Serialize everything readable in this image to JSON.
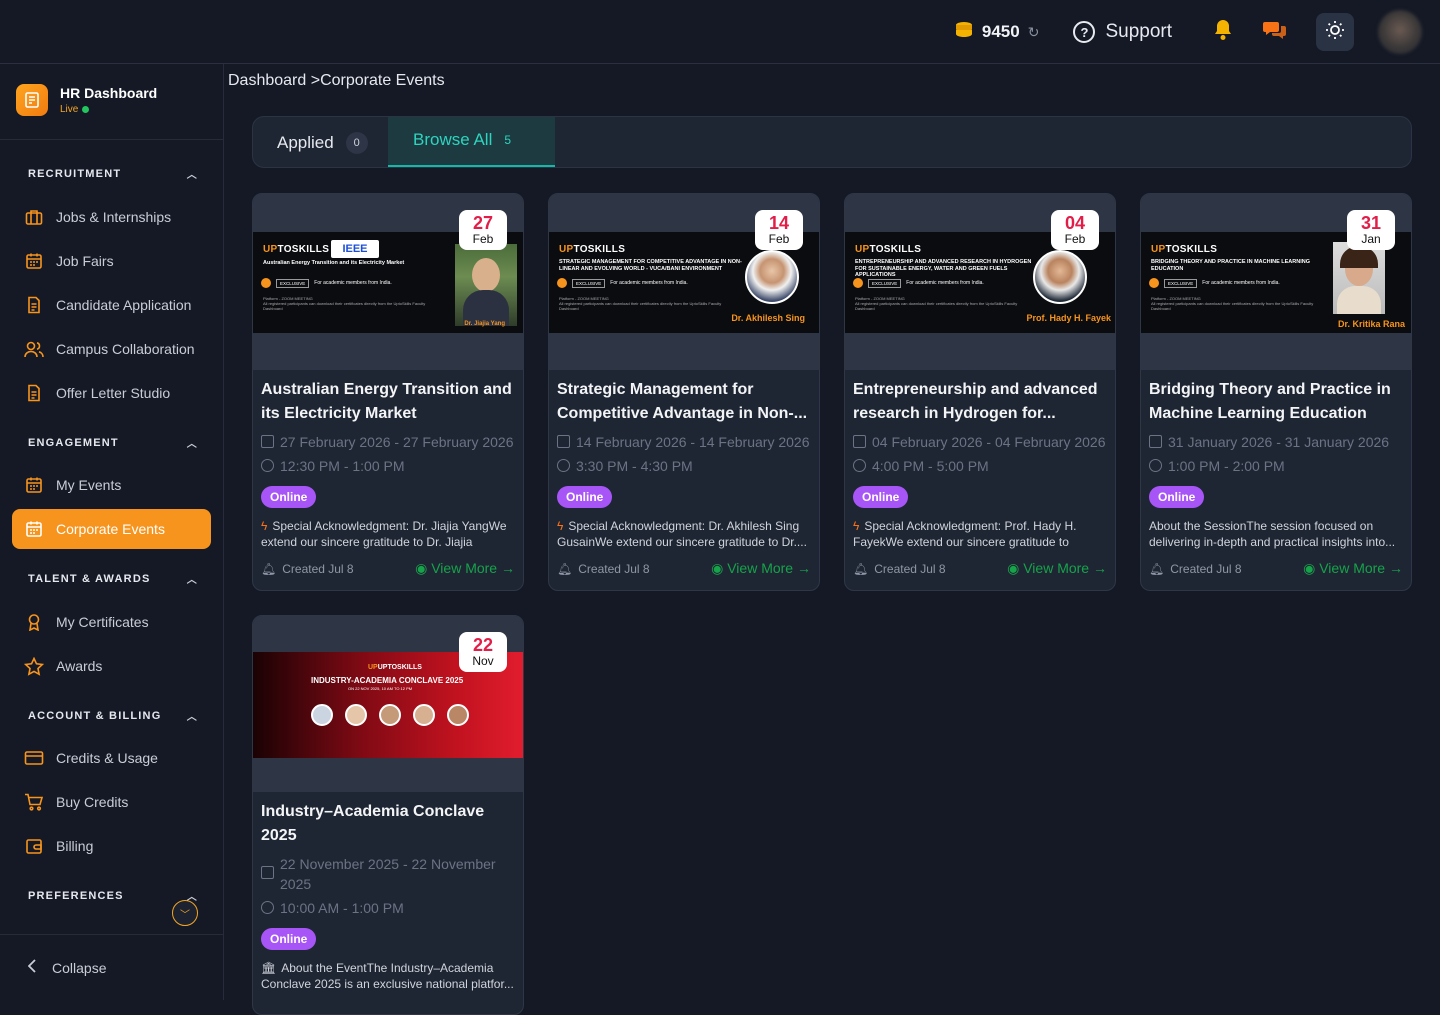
{
  "topbar": {
    "credits": "9450",
    "support_label": "Support"
  },
  "brand": {
    "title": "HR Dashboard",
    "status": "Live"
  },
  "sidebar": {
    "sections": [
      {
        "label": "RECRUITMENT",
        "items": [
          "Jobs & Internships",
          "Job Fairs",
          "Candidate Application",
          "Campus Collaboration",
          "Offer Letter Studio"
        ]
      },
      {
        "label": "ENGAGEMENT",
        "items": [
          "My Events",
          "Corporate Events"
        ]
      },
      {
        "label": "TALENT & AWARDS",
        "items": [
          "My Certificates",
          "Awards"
        ]
      },
      {
        "label": "ACCOUNT & BILLING",
        "items": [
          "Credits & Usage",
          "Buy Credits",
          "Billing"
        ]
      },
      {
        "label": "PREFERENCES",
        "items": []
      }
    ],
    "active_item": "Corporate Events",
    "collapse_label": "Collapse"
  },
  "breadcrumb": "Dashboard >Corporate Events",
  "tabs": [
    {
      "label": "Applied",
      "count": "0"
    },
    {
      "label": "Browse All",
      "count": "5"
    }
  ],
  "colors": {
    "accent": "#f7941d",
    "teal": "#14b8a6",
    "online": "#a855f7",
    "view_more": "#16a34a",
    "date": "#e11d48"
  },
  "events": [
    {
      "day": "27",
      "month": "Feb",
      "title": "Australian Energy Transition and its Electricity Market",
      "dates": "27 February 2026 - 27 February 2026",
      "time": "12:30 PM - 1:00 PM",
      "mode": "Online",
      "desc": "Special Acknowledgment: Dr. Jiajia YangWe extend our sincere gratitude to Dr. Jiajia Yang,...",
      "created": "Created Jul 8",
      "view_more": "View More →",
      "banner_title": "Australian Energy Transition and its Electricity Market",
      "speaker": "Dr. Jiajia Yang"
    },
    {
      "day": "14",
      "month": "Feb",
      "title": "Strategic Management for Competitive Advantage in Non-...",
      "dates": "14 February 2026 - 14 February 2026",
      "time": "3:30 PM - 4:30 PM",
      "mode": "Online",
      "desc": "Special Acknowledgment: Dr. Akhilesh Sing GusainWe extend our sincere gratitude to Dr....",
      "created": "Created Jul 8",
      "view_more": "View More →",
      "banner_title": "STRATEGIC MANAGEMENT FOR COMPETITIVE ADVANTAGE IN NON-LINEAR AND EVOLVING WORLD - VUCA/BANI ENVIRONMENT",
      "speaker": "Dr. Akhilesh Sing"
    },
    {
      "day": "04",
      "month": "Feb",
      "title": "Entrepreneurship and advanced research in Hydrogen for...",
      "dates": "04 February 2026 - 04 February 2026",
      "time": "4:00 PM - 5:00 PM",
      "mode": "Online",
      "desc": "Special Acknowledgment: Prof. Hady H. FayekWe extend our sincere gratitude to Prof....",
      "created": "Created Jul 8",
      "view_more": "View More →",
      "banner_title": "ENTREPRENEURSHIP AND ADVANCED RESEARCH IN HYDROGEN FOR SUSTAINABLE ENERGY, WATER AND GREEN FUELS APPLICATIONS",
      "speaker": "Prof. Hady H. Fayek"
    },
    {
      "day": "31",
      "month": "Jan",
      "title": "Bridging Theory and Practice in Machine Learning Education",
      "dates": "31 January 2026 - 31 January 2026",
      "time": "1:00 PM - 2:00 PM",
      "mode": "Online",
      "desc": "About the SessionThe session focused on delivering in-depth and practical insights into...",
      "created": "Created Jul 8",
      "view_more": "View More →",
      "banner_title": "BRIDGING THEORY AND PRACTICE IN MACHINE LEARNING EDUCATION",
      "speaker": "Dr. Kritika Rana"
    },
    {
      "day": "22",
      "month": "Nov",
      "title": "Industry–Academia Conclave 2025",
      "dates": "22 November 2025 - 22 November 2025",
      "time": "10:00 AM - 1:00 PM",
      "mode": "Online",
      "desc": "About the EventThe Industry–Academia Conclave 2025 is an exclusive national platfor...",
      "banner_title": "INDUSTRY-ACADEMIA CONCLAVE 2025",
      "banner_sub": "ON 22 NOV 2025, 10 AM TO 12 PM"
    }
  ],
  "banner_common": {
    "brand": "UPTOSKILLS",
    "audience": "For academic members from India.",
    "exclusive": "EXCLUSIVE",
    "platform": "Platform - ZOOM MEETING",
    "note": "All registered participants can download their certificates directly from the UptoSkills Faculty Dashboard"
  }
}
